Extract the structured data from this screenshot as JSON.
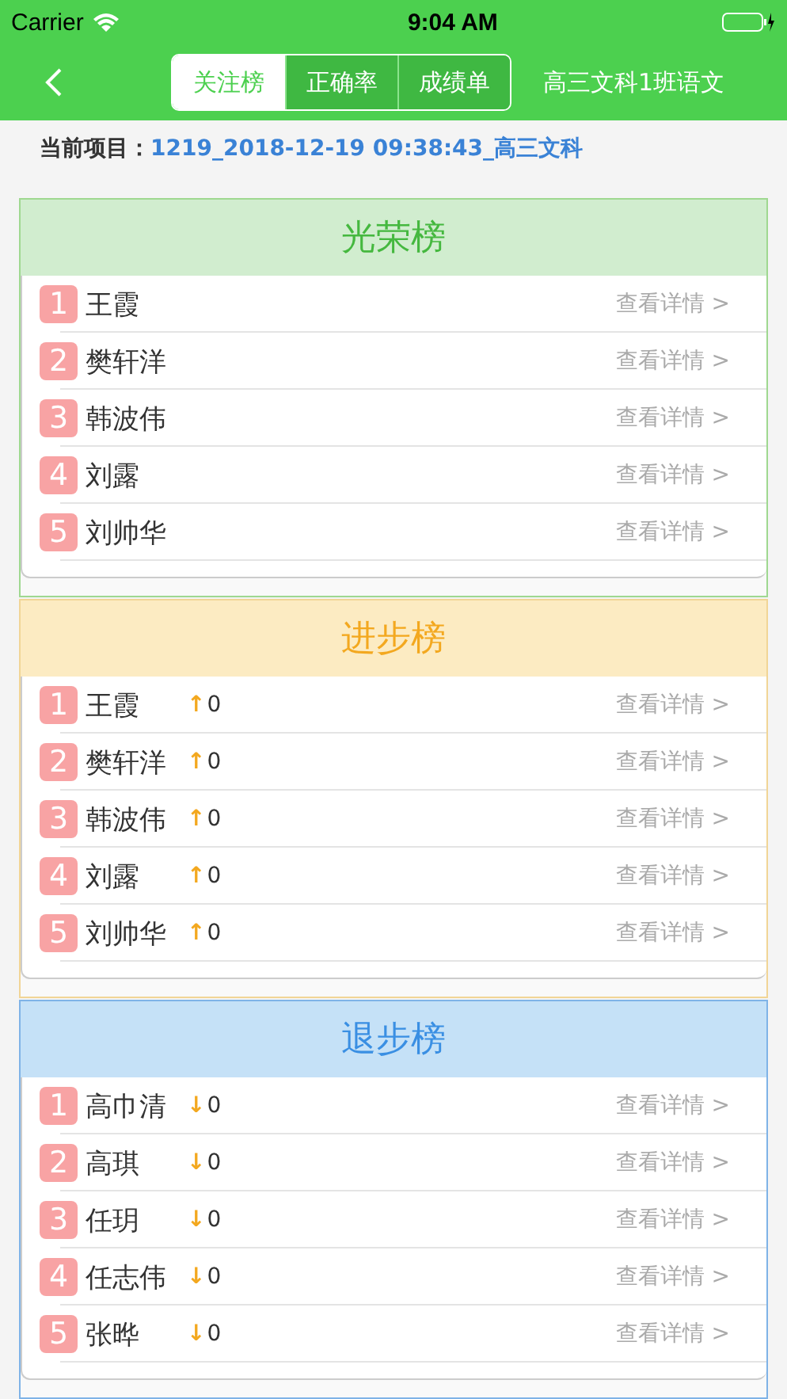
{
  "status_bar": {
    "carrier": "Carrier",
    "time": "9:04 AM"
  },
  "nav": {
    "segments": [
      {
        "label": "关注榜",
        "selected": true
      },
      {
        "label": "正确率",
        "selected": false
      },
      {
        "label": "成绩单",
        "selected": false
      }
    ],
    "title": "高三文科1班语文"
  },
  "current_project": {
    "label": "当前项目：",
    "value": "1219_2018-12-19 09:38:43_高三文科"
  },
  "boards": [
    {
      "kind": "glory",
      "title": "光荣榜",
      "rows": [
        {
          "rank": "1",
          "name": "王霞",
          "detail": "查看详情 >"
        },
        {
          "rank": "2",
          "name": "樊轩洋",
          "detail": "查看详情 >"
        },
        {
          "rank": "3",
          "name": "韩波伟",
          "detail": "查看详情 >"
        },
        {
          "rank": "4",
          "name": "刘露",
          "detail": "查看详情 >"
        },
        {
          "rank": "5",
          "name": "刘帅华",
          "detail": "查看详情 >"
        }
      ]
    },
    {
      "kind": "progress",
      "title": "进步榜",
      "rows": [
        {
          "rank": "1",
          "name": "王霞",
          "arrow": "↑",
          "change": "0",
          "detail": "查看详情 >"
        },
        {
          "rank": "2",
          "name": "樊轩洋",
          "arrow": "↑",
          "change": "0",
          "detail": "查看详情 >"
        },
        {
          "rank": "3",
          "name": "韩波伟",
          "arrow": "↑",
          "change": "0",
          "detail": "查看详情 >"
        },
        {
          "rank": "4",
          "name": "刘露",
          "arrow": "↑",
          "change": "0",
          "detail": "查看详情 >"
        },
        {
          "rank": "5",
          "name": "刘帅华",
          "arrow": "↑",
          "change": "0",
          "detail": "查看详情 >"
        }
      ]
    },
    {
      "kind": "regress",
      "title": "退步榜",
      "rows": [
        {
          "rank": "1",
          "name": "高巾清",
          "arrow": "↓",
          "change": "0",
          "detail": "查看详情 >"
        },
        {
          "rank": "2",
          "name": "高琪",
          "arrow": "↓",
          "change": "0",
          "detail": "查看详情 >"
        },
        {
          "rank": "3",
          "name": "任玥",
          "arrow": "↓",
          "change": "0",
          "detail": "查看详情 >"
        },
        {
          "rank": "4",
          "name": "任志伟",
          "arrow": "↓",
          "change": "0",
          "detail": "查看详情 >"
        },
        {
          "rank": "5",
          "name": "张晔",
          "arrow": "↓",
          "change": "0",
          "detail": "查看详情 >"
        }
      ]
    }
  ]
}
